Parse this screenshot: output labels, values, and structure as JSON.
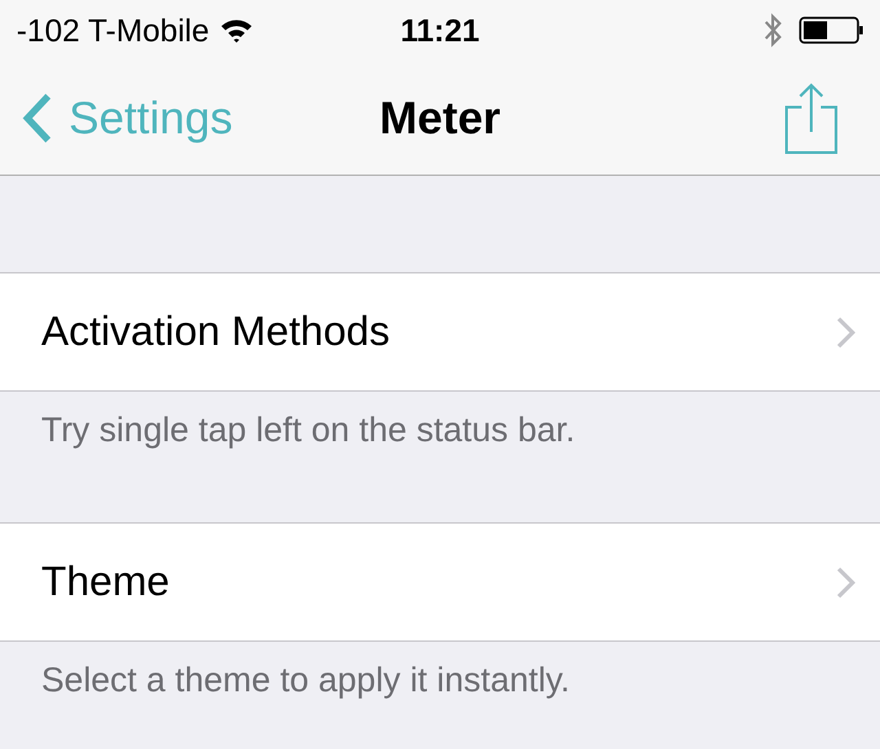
{
  "status_bar": {
    "carrier": "-102 T-Mobile",
    "time": "11:21"
  },
  "nav_bar": {
    "back": "Settings",
    "title": "Meter"
  },
  "sections": [
    {
      "row": "Activation Methods",
      "footer": "Try single tap left on the status bar."
    },
    {
      "row": "Theme",
      "footer": "Select a theme to apply it instantly."
    }
  ]
}
